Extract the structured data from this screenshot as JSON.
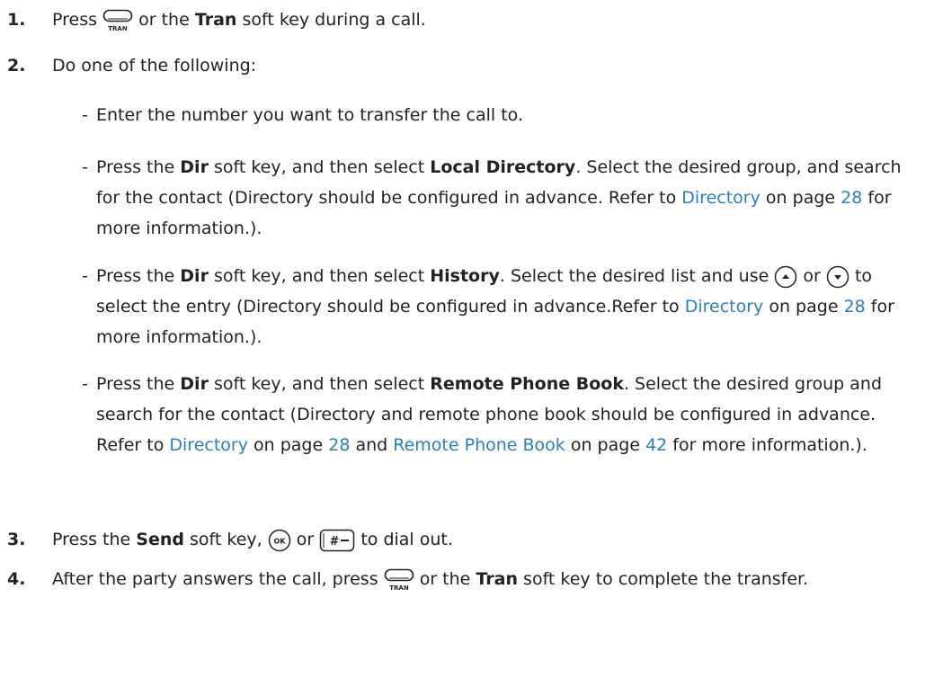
{
  "icons": {
    "tran": "transfer-key-icon",
    "tran_label": "TRAN",
    "up": "up-arrow-key-icon",
    "down": "down-arrow-key-icon",
    "ok": "ok-key-icon",
    "ok_label": "OK",
    "send": "pound-send-key-icon",
    "send_label": "#"
  },
  "steps": {
    "s1": {
      "num": "1.",
      "t1": "Press",
      "t2": "or the",
      "b1": "Tran",
      "t3": "soft key during a call."
    },
    "s2": {
      "num": "2.",
      "t1": "Do one of the following:"
    },
    "s3": {
      "num": "3.",
      "t1": "Press the",
      "b1": "Send",
      "t2": "soft key,",
      "t3": "or",
      "t4": "to dial out."
    },
    "s4": {
      "num": "4.",
      "t1": "After the party answers the call, press",
      "t2": "or the",
      "b1": "Tran",
      "t3": "soft key to complete the transfer."
    }
  },
  "options": {
    "o1": {
      "dash": "-",
      "t1": "Enter the number you want to transfer the call to."
    },
    "o2": {
      "dash": "-",
      "t1": "Press the",
      "b1": "Dir",
      "t2": "soft key, and then select",
      "b2": "Local Directory",
      "t3": ". Select the desired group, and search for the contact (Directory should be configured in advance. Refer to",
      "l1": "Directory",
      "t4": "on page",
      "p1": "28",
      "t5": "for more information.)."
    },
    "o3": {
      "dash": "-",
      "t1": "Press the",
      "b1": "Dir",
      "t2": "soft key, and then select",
      "b2": "History",
      "t3": ". Select the desired list and use",
      "t4": "or",
      "t5": "to select the entry (Directory should be configured in advance.Refer to",
      "l1": "Directory",
      "t6": "on page",
      "p1": "28",
      "t7": "for more information.)."
    },
    "o4": {
      "dash": "-",
      "t1": "Press the",
      "b1": "Dir",
      "t2": "soft key, and then select",
      "b2": "Remote Phone Book",
      "t3": ". Select the desired group and search for the contact (Directory and remote phone book should be configured in advance. Refer to",
      "l1": "Directory",
      "t4": "on page",
      "p1": "28",
      "t5": "and",
      "l2": "Remote Phone Book",
      "t6": "on page",
      "p2": "42",
      "t7": "for more information.)."
    }
  }
}
